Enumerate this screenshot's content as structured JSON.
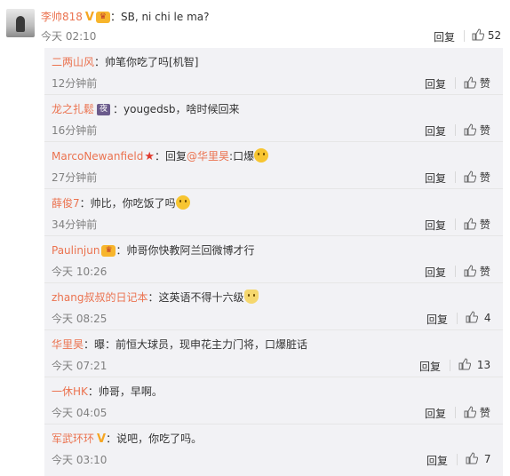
{
  "main_comment": {
    "user": "李帅818",
    "text": "：SB, ni chi le ma?",
    "time": "今天 02:10",
    "reply_label": "回复",
    "likes": "52"
  },
  "replies": [
    {
      "user": "二两山风",
      "text": "：帅笔你吃了吗[机智]",
      "time": "12分钟前",
      "reply_label": "回复",
      "likes": "赞",
      "badge": ""
    },
    {
      "user": "龙之扎鬆",
      "text": "：yougedsb，啥时候回来",
      "time": "16分钟前",
      "reply_label": "回复",
      "likes": "赞",
      "badge": "夜"
    },
    {
      "user": "MarcoNewanfield",
      "text": "：回复",
      "mention": "@华里昊",
      "text2": ":口爆",
      "time": "27分钟前",
      "reply_label": "回复",
      "likes": "赞"
    },
    {
      "user": "薛俊7",
      "text": "：帅比，你吃饭了吗",
      "time": "34分钟前",
      "reply_label": "回复",
      "likes": "赞"
    },
    {
      "user": "Paulinjun",
      "text": "：帅哥你快教阿兰回微博才行",
      "time": "今天 10:26",
      "reply_label": "回复",
      "likes": "赞"
    },
    {
      "user": "zhang叔叔的日记本",
      "text": "：这英语不得十六级",
      "time": "今天 08:25",
      "reply_label": "回复",
      "likes": "4"
    },
    {
      "user": "华里昊",
      "text": "：曝：前恒大球员，现申花主力门将，口爆脏话",
      "time": "今天 07:21",
      "reply_label": "回复",
      "likes": "13"
    },
    {
      "user": "一休HK",
      "text": "：帅哥，早啊。",
      "time": "今天 04:05",
      "reply_label": "回复",
      "likes": "赞"
    },
    {
      "user": "军武环环",
      "text": "：说吧，你吃了吗。",
      "time": "今天 03:10",
      "reply_label": "回复",
      "likes": "7"
    }
  ]
}
